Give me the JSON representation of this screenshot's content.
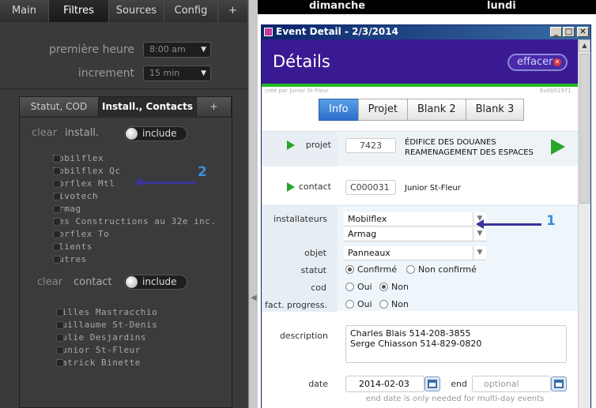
{
  "left_panel": {
    "tabs": [
      {
        "label": "Main"
      },
      {
        "label": "Filtres"
      },
      {
        "label": "Sources"
      },
      {
        "label": "Config"
      },
      {
        "label": "+"
      }
    ],
    "premiere_heure": {
      "label": "première heure",
      "value": "8:00 am"
    },
    "increment": {
      "label": "increment",
      "value": "15 min"
    },
    "subtabs": [
      {
        "label": "Statut, COD"
      },
      {
        "label": "Install., Contacts"
      },
      {
        "label": "+"
      }
    ],
    "install": {
      "clear": "clear",
      "label": "install.",
      "toggle": "include",
      "items": [
        "Mobilflex",
        "Mobilflex Qc",
        "Corflex Mtl",
        "Pivotech",
        "Armag",
        "Les Constructions au 32e inc.",
        "Corflex To",
        "Clients",
        "Autres"
      ]
    },
    "contact": {
      "clear": "clear",
      "label": "contact",
      "toggle": "include",
      "items": [
        "Gilles Mastracchio",
        "Guillaume St-Denis",
        "Julie Desjardins",
        "Junior St-Fleur",
        "Patrick Binette"
      ]
    }
  },
  "calendar": {
    "day1": "dimanche",
    "day2": "lundi"
  },
  "dialog": {
    "title": "Event Detail - 2/3/2014",
    "header": "Détails",
    "clear_button": "effacer",
    "created_by": "créé par Junior St-Fleur",
    "event_id": "Ev0001971",
    "tabs": [
      {
        "label": "Info"
      },
      {
        "label": "Projet"
      },
      {
        "label": "Blank 2"
      },
      {
        "label": "Blank 3"
      }
    ],
    "projet": {
      "label": "projet",
      "code": "7423",
      "line1": "ÉDIFICE DES DOUANES",
      "line2": "REAMENAGEMENT DES ESPACES"
    },
    "contact": {
      "label": "contact",
      "code": "C000031",
      "name": "Junior St-Fleur"
    },
    "installateurs": {
      "label": "installateurs",
      "values": [
        "Mobilflex",
        "Armag"
      ]
    },
    "objet": {
      "label": "objet",
      "value": "Panneaux"
    },
    "statut": {
      "label": "statut",
      "options": [
        "Confirmé",
        "Non confirmé"
      ]
    },
    "cod": {
      "label": "cod",
      "options": [
        "Oui",
        "Non"
      ]
    },
    "fact": {
      "label": "fact. progress.",
      "options": [
        "Oui",
        "Non"
      ]
    },
    "description": {
      "label": "description",
      "line1": "Charles Blais 514-208-3855",
      "line2": "Serge Chiasson 514-829-0820"
    },
    "date": {
      "label": "date",
      "value": "2014-02-03",
      "end_label": "end",
      "end_placeholder": "optional",
      "hint": "end date is only needed for multi-day events"
    }
  },
  "annotations": {
    "n1": "1",
    "n2": "2"
  },
  "colors": {
    "header_bg": "#3a1a93",
    "accent_green": "#22bb22",
    "active_tab": "#2d6fcc",
    "arrow": "#3b3499",
    "annotation_number": "#3a8fe0"
  }
}
